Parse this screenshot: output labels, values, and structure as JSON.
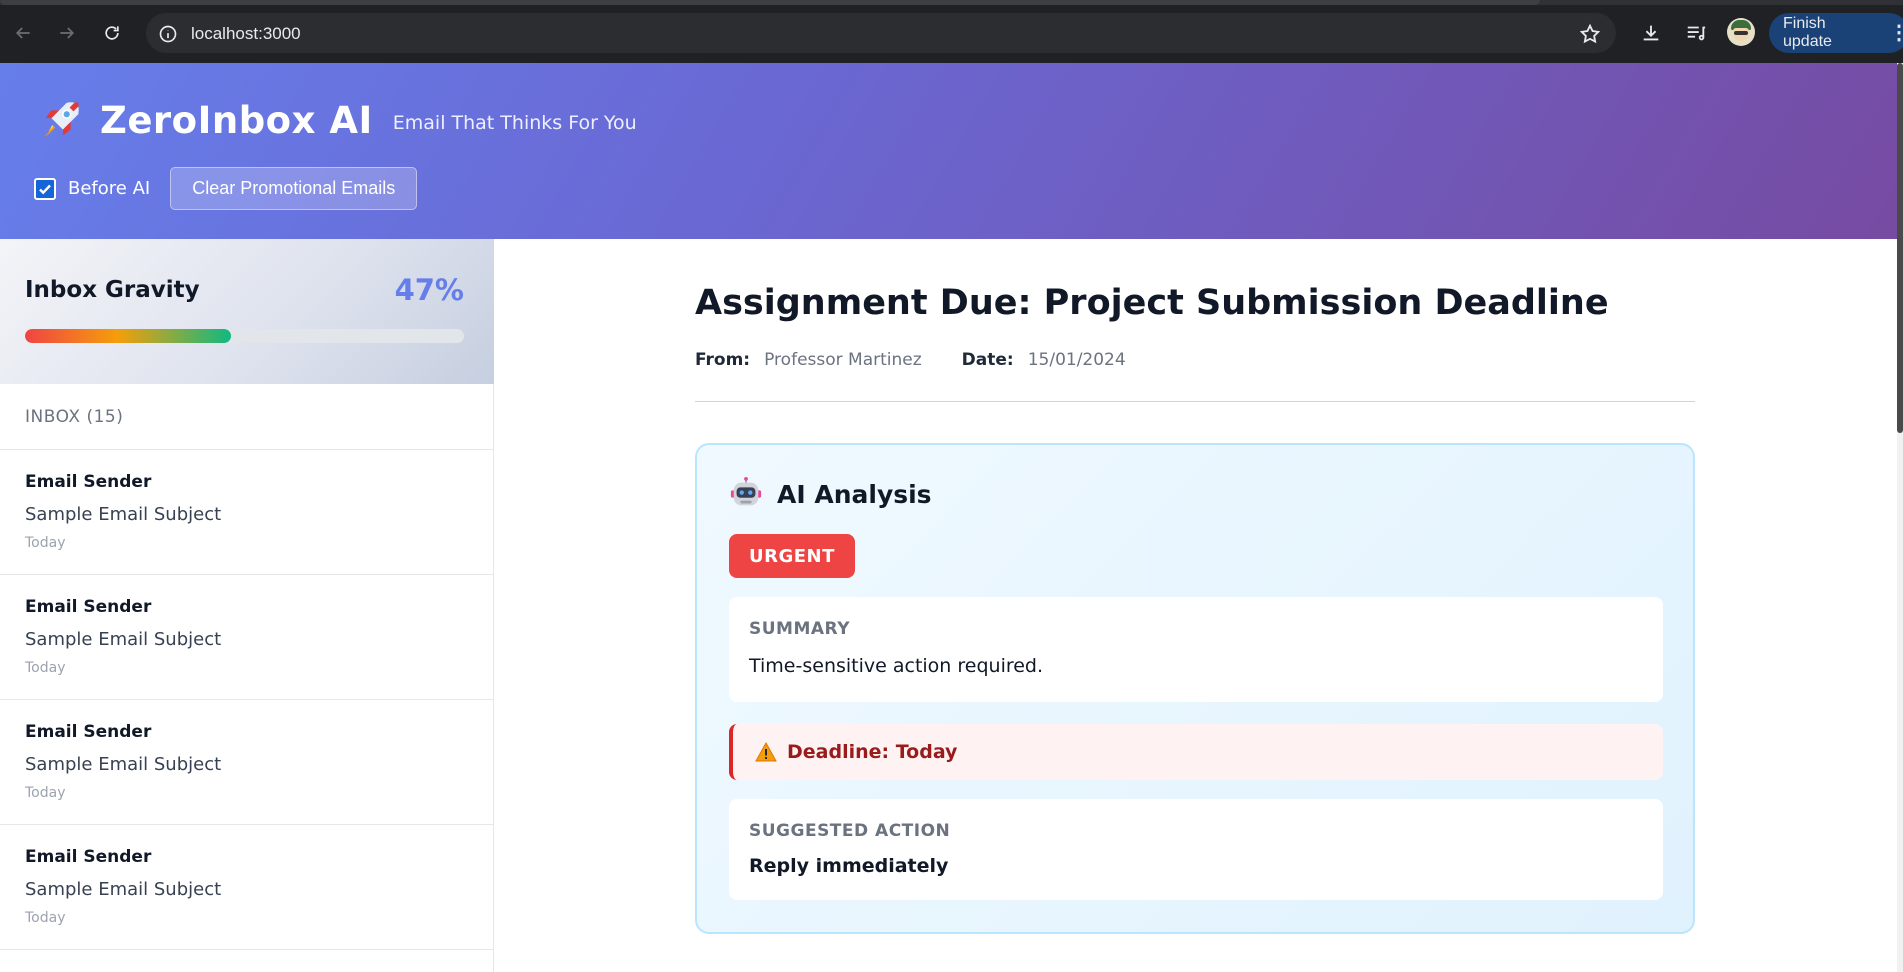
{
  "browser": {
    "url": "localhost:3000",
    "finish_update_label": "Finish update"
  },
  "header": {
    "title": "ZeroInbox AI",
    "tagline": "Email That Thinks For You",
    "before_ai_label": "Before AI",
    "before_ai_checked": true,
    "clear_button_label": "Clear Promotional Emails",
    "accent_gradient": [
      "#667eea",
      "#764ba2"
    ]
  },
  "sidebar": {
    "gravity_title": "Inbox Gravity",
    "gravity_percent_label": "47%",
    "gravity_value": 0.47,
    "inbox_label": "INBOX (15)",
    "emails": [
      {
        "sender": "Email Sender",
        "subject": "Sample Email Subject",
        "date": "Today"
      },
      {
        "sender": "Email Sender",
        "subject": "Sample Email Subject",
        "date": "Today"
      },
      {
        "sender": "Email Sender",
        "subject": "Sample Email Subject",
        "date": "Today"
      },
      {
        "sender": "Email Sender",
        "subject": "Sample Email Subject",
        "date": "Today"
      }
    ]
  },
  "email": {
    "title": "Assignment Due: Project Submission Deadline",
    "from_label": "From:",
    "from_value": "Professor Martinez",
    "date_label": "Date:",
    "date_value": "15/01/2024"
  },
  "analysis": {
    "title": "AI Analysis",
    "priority_badge": "URGENT",
    "priority_color": "#ef4444",
    "summary_label": "SUMMARY",
    "summary_text": "Time-sensitive action required.",
    "deadline_text": "Deadline: Today",
    "action_label": "SUGGESTED ACTION",
    "action_text": "Reply immediately"
  }
}
